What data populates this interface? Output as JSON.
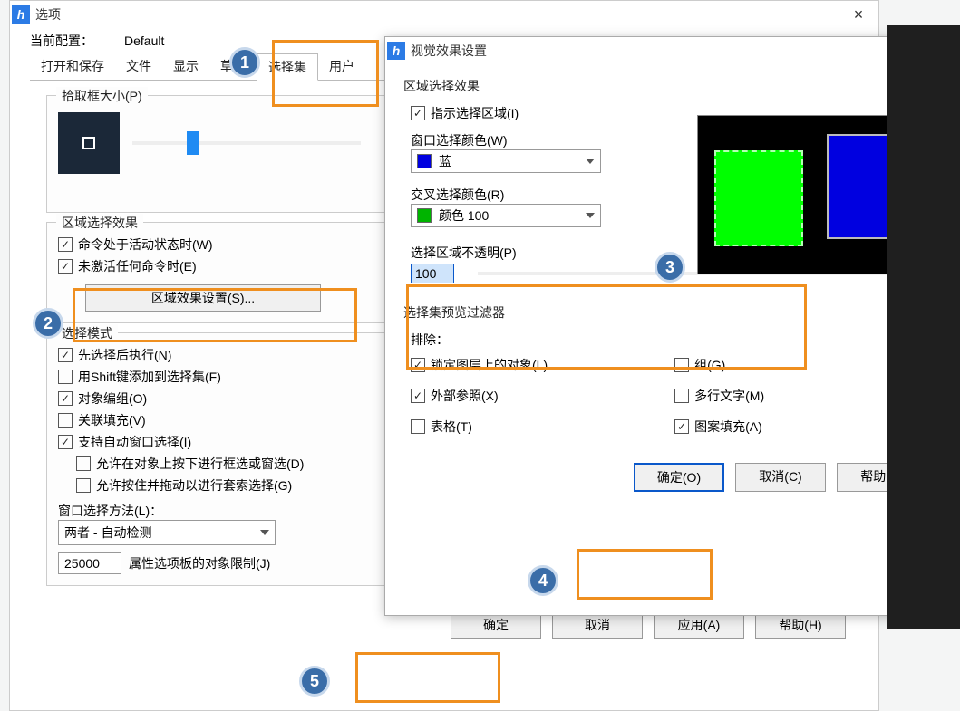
{
  "mainWindow": {
    "title": "选项",
    "currentConfigLabel": "当前配置：",
    "currentConfigValue": "Default",
    "tabs": {
      "openSave": "打开和保存",
      "file": "文件",
      "display": "显示",
      "sketch": "草图",
      "selectionSet": "选择集",
      "user": "用户"
    },
    "pickbox": {
      "sectionTitle": "拾取框大小(P)"
    },
    "areaEffect": {
      "sectionTitle": "区域选择效果",
      "activeCmd": "命令处于活动状态时(W)",
      "noActiveCmd": "未激活任何命令时(E)",
      "settingsBtn": "区域效果设置(S)..."
    },
    "selectMode": {
      "sectionTitle": "选择模式",
      "preExec": "先选择后执行(N)",
      "shiftAdd": "用Shift键添加到选择集(F)",
      "objGroup": "对象编组(O)",
      "assocFill": "关联填充(V)",
      "autoWindow": "支持自动窗口选择(I)",
      "allowFramePress": "允许在对象上按下进行框选或窗选(D)",
      "allowDragLasso": "允许按住并拖动以进行套索选择(G)",
      "windowMethodLabel": "窗口选择方法(L)：",
      "windowMethodValue": "两者 - 自动检测",
      "limitValue": "25000",
      "limitLabel": "属性选项板的对象限制(J)"
    },
    "bottom": {
      "ok": "确定",
      "cancel": "取消",
      "apply": "应用(A)",
      "help": "帮助(H)"
    }
  },
  "secWindow": {
    "title": "视觉效果设置",
    "areaEffectLabel": "区域选择效果",
    "indicateArea": "指示选择区域(I)",
    "windowColorLabel": "窗口选择颜色(W)",
    "windowColorValue": "蓝",
    "crossColorLabel": "交叉选择颜色(R)",
    "crossColorValue": "颜色 100",
    "opacityLabel": "选择区域不透明(P)",
    "opacityValue": "100",
    "filterHeader": "选择集预览过滤器",
    "filterExclude": "排除：",
    "filters": {
      "locked": "锁定图层上的对象(L)",
      "xref": "外部参照(X)",
      "table": "表格(T)",
      "group": "组(G)",
      "mtext": "多行文字(M)",
      "hatch": "图案填充(A)"
    },
    "bottom": {
      "ok": "确定(O)",
      "cancel": "取消(C)",
      "help": "帮助(H)"
    }
  },
  "callouts": {
    "c1": "1",
    "c2": "2",
    "c3": "3",
    "c4": "4",
    "c5": "5"
  }
}
